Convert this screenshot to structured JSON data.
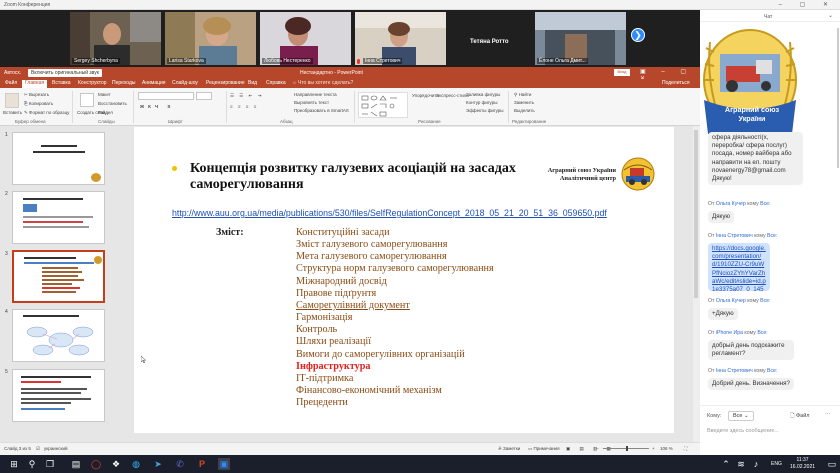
{
  "zoom": {
    "window_title": "Zoom Конференция",
    "participants": [
      {
        "name": "Sergey Shcherbyna"
      },
      {
        "name": "Larisa Starkova"
      },
      {
        "name": "Любовь Нестеренко"
      },
      {
        "name": "Інна Стретович"
      },
      {
        "name": "Тетяна Ротто"
      },
      {
        "name": "Ёлоне Ольга Дмит..."
      }
    ]
  },
  "ppt": {
    "title_left": "Автосх.",
    "share_sound": "Включить оригинальный звук",
    "window_title": "Нестандартно - PowerPoint",
    "sign_in": "Вход",
    "share_label": "Поделиться",
    "tabs": [
      "Файл",
      "Главная",
      "Вставка",
      "Конструктор",
      "Переходы",
      "Анимация",
      "Слайд-шоу",
      "Рецензирование",
      "Вид",
      "Справка",
      "Что вы хотите сделать?"
    ],
    "active_tab": "Главная",
    "ribbon": {
      "paste": "Вставить",
      "cut": "Вырезать",
      "copy": "Копировать",
      "format": "Формат по образцу",
      "clipboard": "Буфер обмена",
      "create": "Создать слайд",
      "layout": "Макет",
      "reset": "Восстановить",
      "section": "Раздел",
      "slides": "Слайды",
      "font": "Шрифт",
      "paragraph": "Абзац",
      "text_dir": "Направление текста",
      "align": "Выровнять текст",
      "smartart": "Преобразовать в SmartArt",
      "drawing": "Рисование",
      "arrange": "Упорядочить",
      "quick_styles": "Экспресс-стили",
      "fill": "Заливка фигуры",
      "outline": "Контур фигуры",
      "effects": "Эффекты фигуры",
      "find": "Найти",
      "replace": "Заменить",
      "select": "Выделить",
      "editing": "Редактирование"
    },
    "slide_numbers": [
      "1",
      "2",
      "3",
      "4",
      "5"
    ],
    "status": {
      "slide": "Слайд 3 из 5",
      "lang": "украинский",
      "notes": "Заметки",
      "comments": "Примечания",
      "zoom": "106 %"
    }
  },
  "slide": {
    "title": "Концепція розвитку галузевих асоціацій на засадах саморегулювання",
    "org_line1": "Аграрний союз України",
    "org_line2": "Аналітичний центр",
    "url": "http://www.auu.org.ua/media/publications/530/files/SelfRegulationConcept_2018_05_21_20_51_36_059650.pdf",
    "contents_label": "Зміст:",
    "items": [
      "Конституційні засади",
      "Зміст галузевого саморегулювання",
      "Мета галузевого саморегулювання",
      "Структура норм галузевого саморегулювання",
      "Міжнародний досвід",
      "Правове підґрунтя",
      "Саморегулівний документ",
      "Гармонізація",
      "Контроль",
      "Шляхи реалізації",
      "Вимоги до саморегулівних організацій",
      "Інфраструктура",
      "ІТ-підтримка",
      "Фінансово-економічний механізм",
      "Прецеденти"
    ]
  },
  "chat": {
    "title": "Чат",
    "banner_line1": "Аграрний союз",
    "banner_line2": "України",
    "partial_message": "сфера діяльності(х, переробка/ сфера послуг) посада, номер вайбера або направити на ел. пошту novaenergy78@gmail.com Дякую!",
    "messages": [
      {
        "from": "Ольга Кучер",
        "to": "Все",
        "text": "Дякую"
      },
      {
        "from": "Інна Стретович",
        "to": "Все",
        "text": "https://docs.google.com/presentation/d/1910ZZU-Cr9uWPfNciozZYhYVarZhaWc/edit#slide=id.p1e3375a07_0_145"
      },
      {
        "from": "Ольга Кучер",
        "to": "Все",
        "text": "+Дякую"
      },
      {
        "from": "iPhone Ира",
        "to": "Все",
        "text": "добрый день подскажите регламент?"
      },
      {
        "from": "Інна Стретович",
        "to": "Все",
        "text": "Добрий день. Визначення?"
      }
    ],
    "from_prefix": "От",
    "to_word": "кому",
    "to_label": "Кому:",
    "to_value": "Все",
    "file_label": "Файл",
    "input_placeholder": "Введите здесь сообщение..."
  },
  "taskbar": {
    "lang": "ENG",
    "time": "11:37",
    "date": "16.02.2021"
  }
}
